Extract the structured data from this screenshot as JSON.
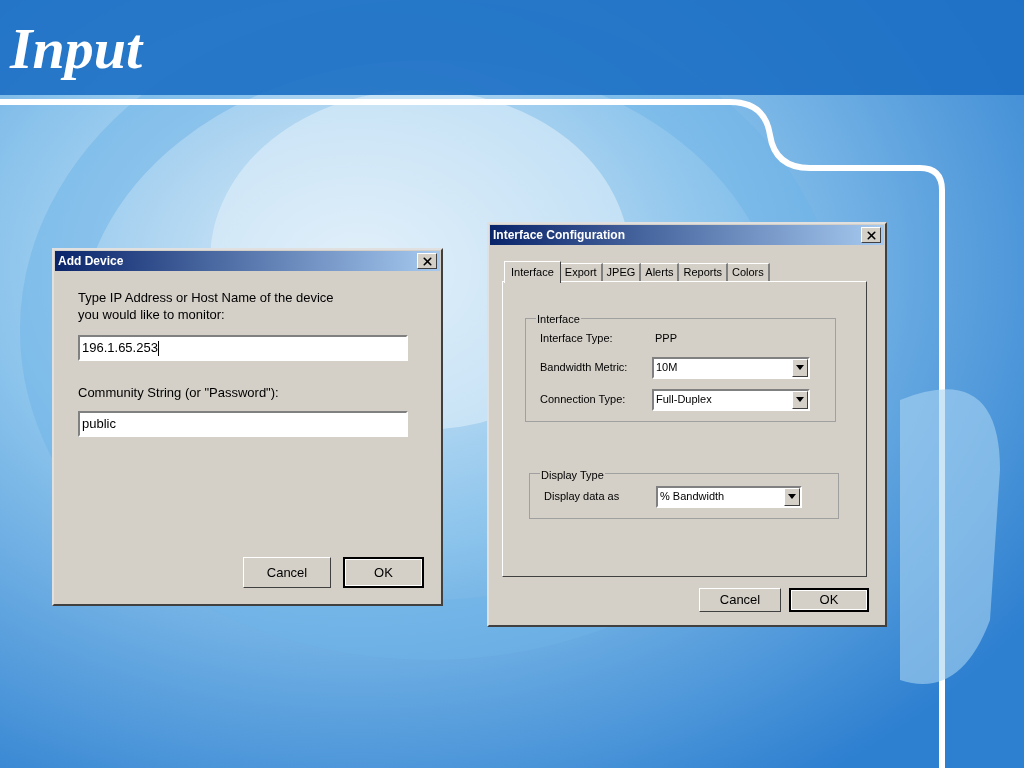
{
  "slide": {
    "title": "Input"
  },
  "add_device": {
    "title": "Add Device",
    "prompt": "Type IP Address or Host Name of the device\nyou would like to monitor:",
    "fields": [
      {
        "value": "196.1.65.253",
        "focused": true
      },
      {
        "label": "Community String (or \"Password\"):",
        "value": "public",
        "focused": false
      }
    ],
    "buttons": [
      {
        "label": "Cancel",
        "default": false
      },
      {
        "label": "OK",
        "default": true
      }
    ]
  },
  "interface_config": {
    "title": "Interface Configuration",
    "tabs": [
      {
        "label": "Interface",
        "selected": true
      },
      {
        "label": "Export",
        "selected": false
      },
      {
        "label": "JPEG",
        "selected": false
      },
      {
        "label": "Alerts",
        "selected": false
      },
      {
        "label": "Reports",
        "selected": false
      },
      {
        "label": "Colors",
        "selected": false
      }
    ],
    "groups": [
      {
        "title": "Interface",
        "rows": [
          {
            "kind": "text",
            "label": "Interface Type:",
            "value": "PPP"
          },
          {
            "kind": "dropdown",
            "label": "Bandwidth Metric:",
            "value": "10M"
          },
          {
            "kind": "dropdown",
            "label": "Connection Type:",
            "value": "Full-Duplex"
          }
        ]
      },
      {
        "title": "Display Type",
        "rows": [
          {
            "kind": "dropdown",
            "label": "Display data as",
            "value": "% Bandwidth"
          }
        ]
      }
    ],
    "buttons": [
      {
        "label": "Cancel",
        "default": false
      },
      {
        "label": "OK",
        "default": true
      }
    ]
  }
}
